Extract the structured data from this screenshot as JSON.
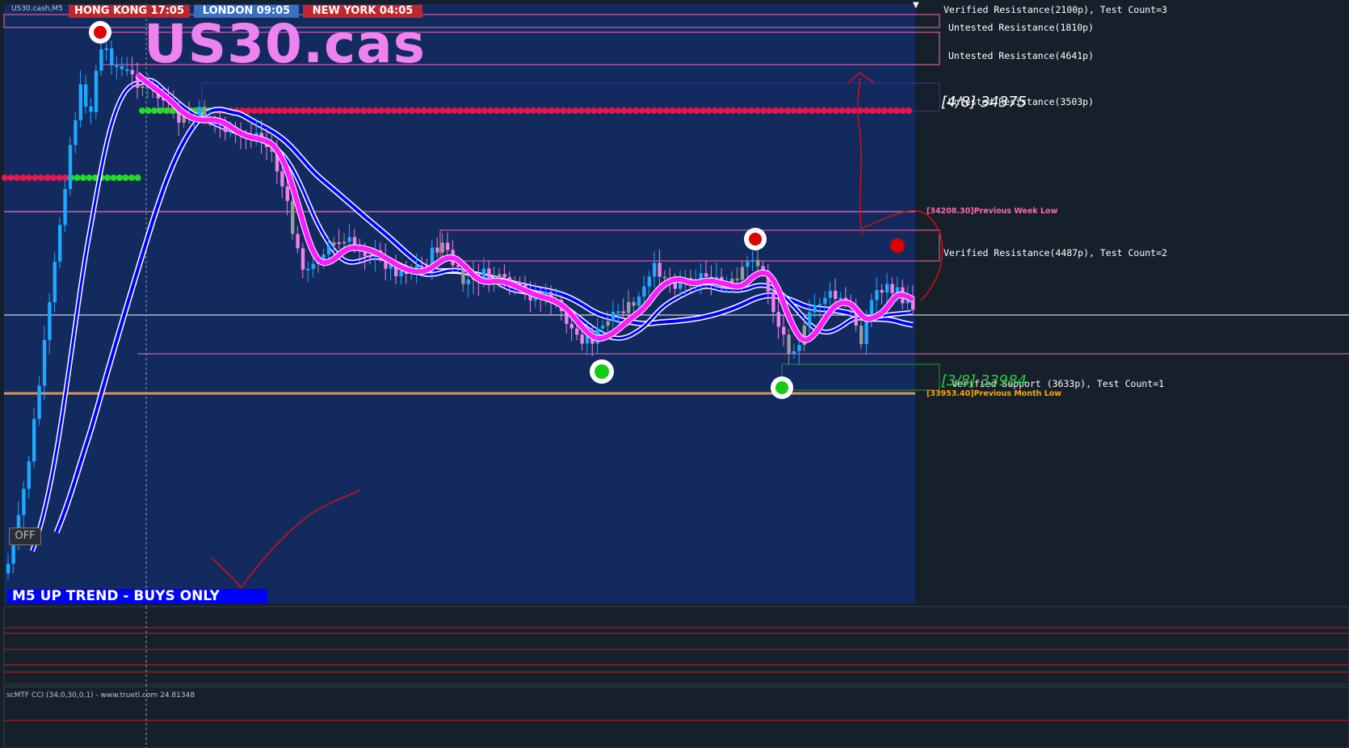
{
  "window": {
    "symbol_label": "US30.cash,M5",
    "big_symbol": "US30.cas"
  },
  "sessions": [
    {
      "label": "HONG KONG  17:05",
      "bg": "#c0272d"
    },
    {
      "label": "LONDON  09:05",
      "bg": "#3a6fc4"
    },
    {
      "label": "NEW YORK  04:05",
      "bg": "#c0272d"
    }
  ],
  "zones": [
    {
      "label": "Verified Resistance(2100p), Test Count=3"
    },
    {
      "label": "Untested Resistance(1810p)"
    },
    {
      "label": "Untested Resistance(4641p)"
    },
    {
      "label": "Untested Resistance(3503p)"
    },
    {
      "label": "Verified Resistance(4487p), Test Count=2"
    },
    {
      "label": "Verified Support (3633p), Test Count=1"
    }
  ],
  "murrey": [
    {
      "label": "[4/8] 34375",
      "color": "#ffffff"
    },
    {
      "label": "[3/8] 33984",
      "color": "#2ecc40"
    }
  ],
  "levels": [
    {
      "label": "[34208.30]Previous Week Low",
      "color": "#ff69b4"
    },
    {
      "label": "[33953.40]Previous Month Low",
      "color": "#ffa500"
    }
  ],
  "banner": {
    "trend": "M5 UP TREND - BUYS ONLY"
  },
  "controls": {
    "off_button": "OFF",
    "collapse_icon": "triangle-down-icon"
  },
  "indicator": {
    "cci_label": "scMTF CCI (34,0,30,0,1) - www.truetl.com 24.81348"
  },
  "colors": {
    "chart_bg": "#132a5e",
    "right_bg": "#16202b",
    "bull": "#1fa8ff",
    "bear": "#ee82ee",
    "neutral": "#9a9a9a",
    "ma_fast": "#ff1aff",
    "ma_slow": "#0000ff",
    "resistance_dots": "#e8174f",
    "support_dots": "#22dd22"
  }
}
